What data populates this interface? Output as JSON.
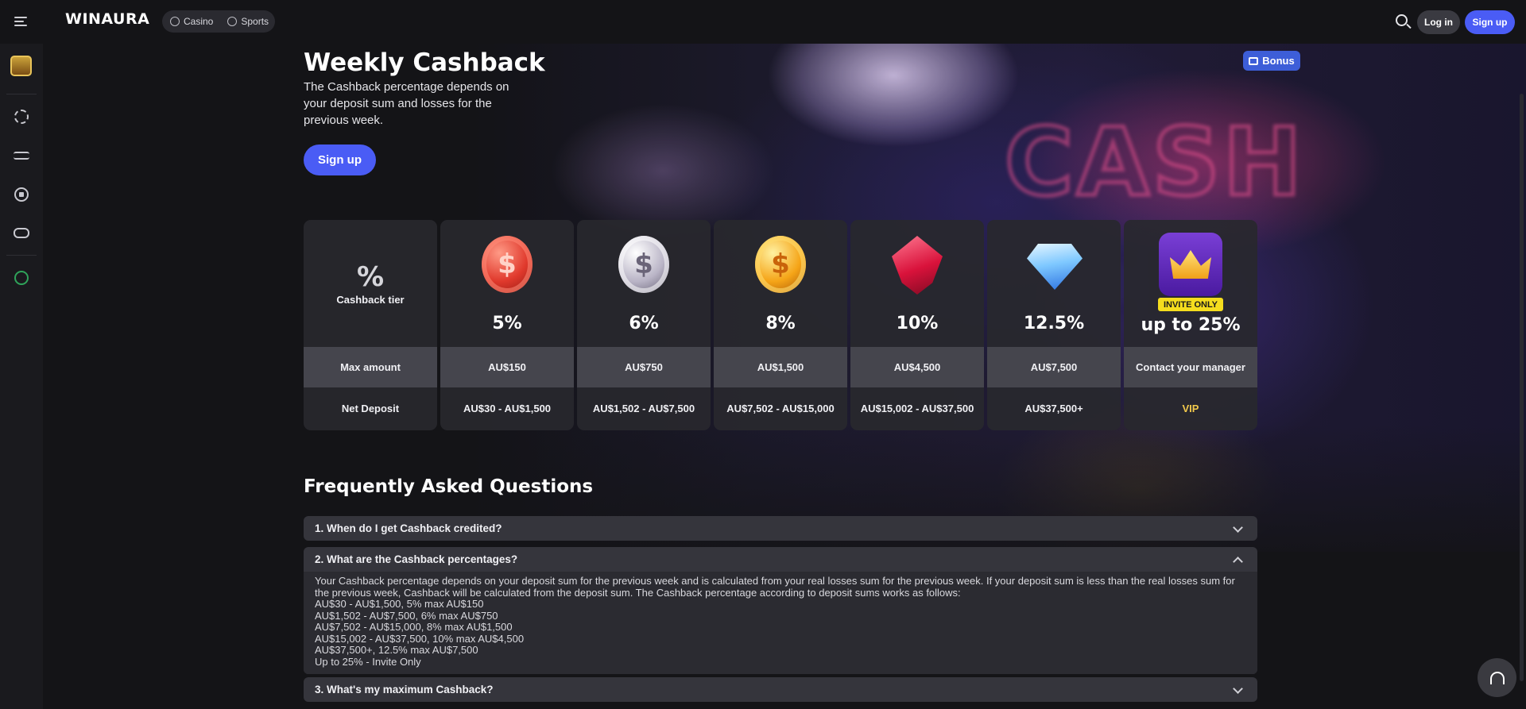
{
  "header": {
    "logo": "WINAURA",
    "tabs": [
      {
        "label": "Casino",
        "icon": "casino-icon"
      },
      {
        "label": "Sports",
        "icon": "sports-icon"
      }
    ],
    "login_label": "Log in",
    "signup_label": "Sign up"
  },
  "sidebar": {
    "items": [
      {
        "name": "rewards-chest",
        "icon": "treasure-chest-icon"
      },
      {
        "name": "casino",
        "icon": "casino-chip-icon"
      },
      {
        "name": "live",
        "icon": "live-broadcast-icon"
      },
      {
        "name": "sports",
        "icon": "soccer-ball-icon"
      },
      {
        "name": "esports",
        "icon": "gamepad-icon"
      },
      {
        "name": "tennis",
        "icon": "tennis-ball-icon"
      }
    ]
  },
  "hero": {
    "title": "Weekly Cashback",
    "subtitle": "The Cashback percentage depends on your deposit sum and losses for the previous week.",
    "signup_label": "Sign up",
    "badge_label": "Bonus"
  },
  "tiers": {
    "label_column": {
      "symbol": "%",
      "tier_label": "Cashback tier",
      "max_label": "Max amount",
      "net_label": "Net Deposit"
    },
    "columns": [
      {
        "icon": "red-coin-icon",
        "percent": "5%",
        "max": "AU$150",
        "net": "AU$30 - AU$1,500"
      },
      {
        "icon": "silver-coin-icon",
        "percent": "6%",
        "max": "AU$750",
        "net": "AU$1,502 - AU$7,500"
      },
      {
        "icon": "gold-coin-icon",
        "percent": "8%",
        "max": "AU$1,500",
        "net": "AU$7,502 - AU$15,000"
      },
      {
        "icon": "ruby-gem-icon",
        "percent": "10%",
        "max": "AU$4,500",
        "net": "AU$15,002 - AU$37,500"
      },
      {
        "icon": "diamond-icon",
        "percent": "12.5%",
        "max": "AU$7,500",
        "net": "AU$37,500+"
      },
      {
        "icon": "crown-icon",
        "badge": "INVITE ONLY",
        "percent": "up to 25%",
        "max": "Contact your manager",
        "net": "VIP"
      }
    ]
  },
  "faq": {
    "title": "Frequently Asked Questions",
    "items": [
      {
        "question": "1.  When do I get Cashback credited?",
        "expanded": false
      },
      {
        "question": "2.  What are the Cashback percentages?",
        "expanded": true,
        "answer": [
          "Your Cashback percentage depends on your deposit sum for the previous week and is calculated from your real losses sum for the previous week. If your deposit sum is less than the real losses sum for the previous week, Cashback will be calculated from the deposit sum. The Cashback percentage according to deposit sums works as follows:",
          "AU$30 - AU$1,500, 5% max AU$150",
          "AU$1,502 - AU$7,500, 6% max AU$750",
          "AU$7,502 - AU$15,000, 8% max AU$1,500",
          "AU$15,002 - AU$37,500, 10% max AU$4,500",
          "AU$37,500+, 12.5% max AU$7,500",
          "Up to 25% - Invite Only"
        ]
      },
      {
        "question": "3.  What's my maximum Cashback?",
        "expanded": false
      }
    ]
  },
  "support": {
    "icon": "headset-icon"
  }
}
